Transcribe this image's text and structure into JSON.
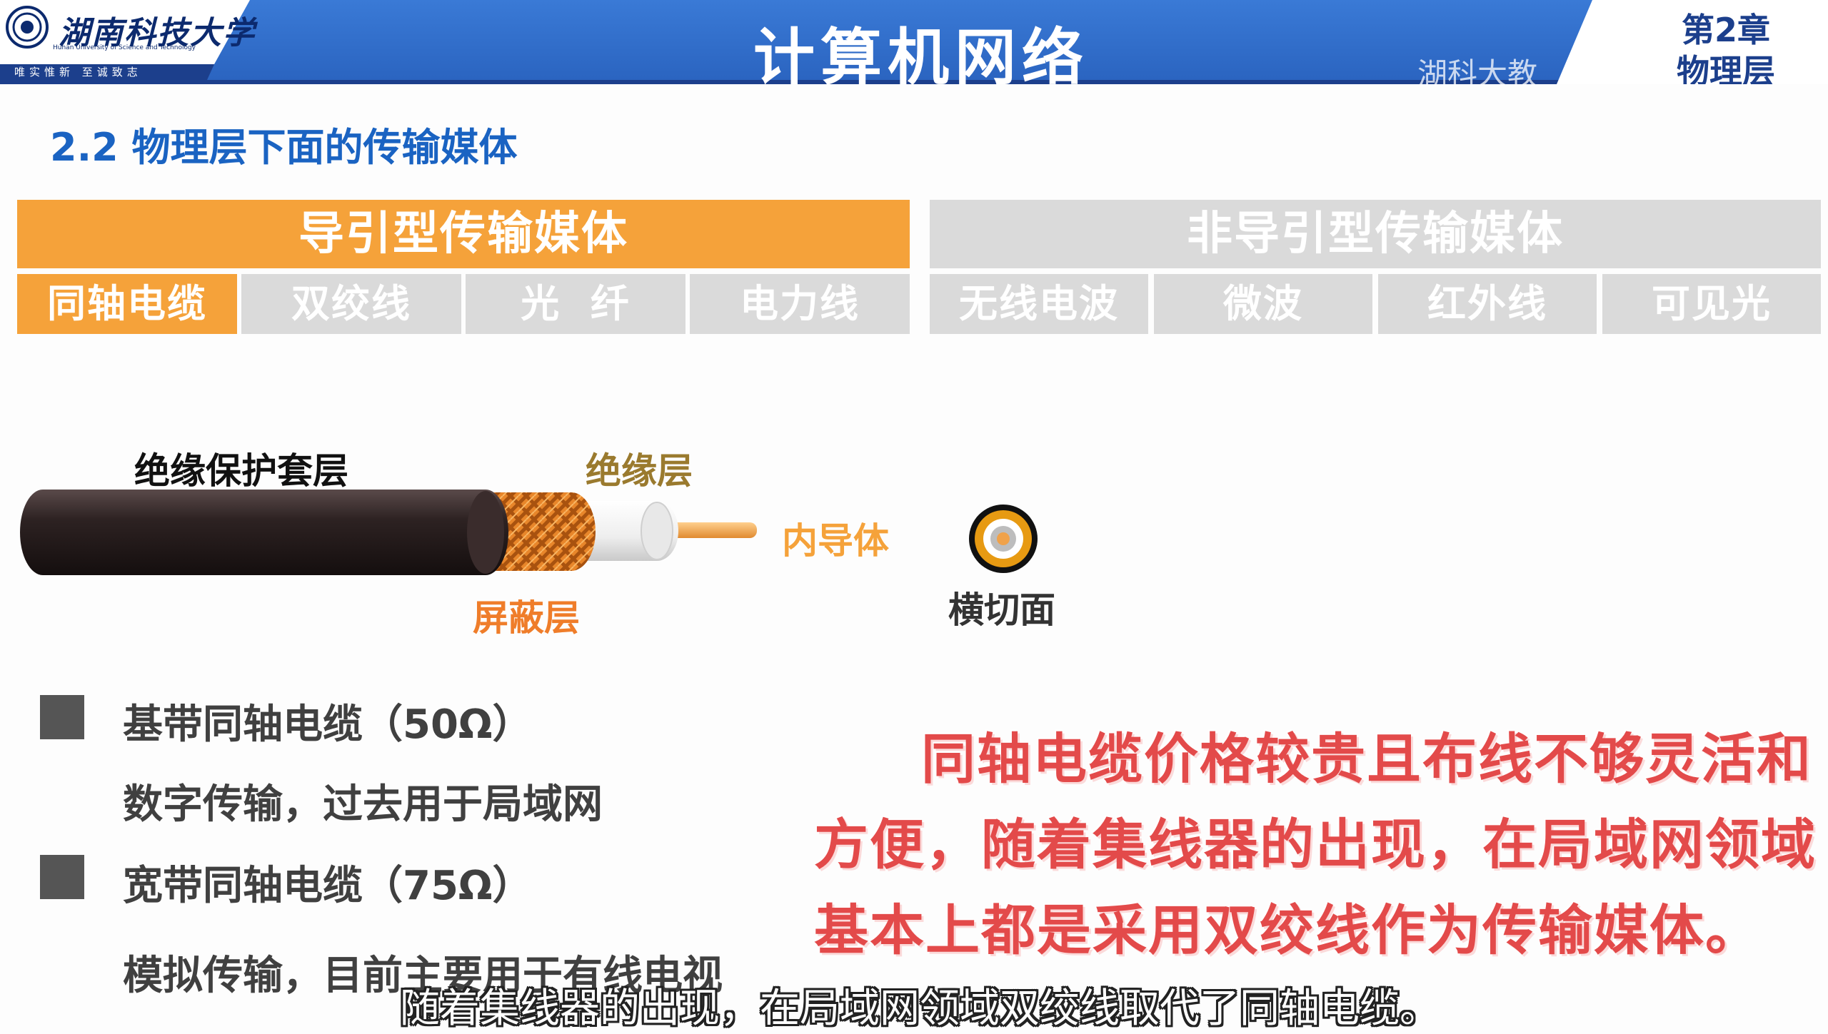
{
  "header": {
    "school_name_cn": "湖南科技大学",
    "school_name_en": "Hunan University of Science and Technology",
    "school_motto": "唯实惟新 至诚致志",
    "course_title": "计算机网络",
    "watermark": "湖科大教",
    "chapter_number": "第2章",
    "chapter_name": "物理层",
    "colors": {
      "band": "#2f6fcf",
      "band_dark": "#1c3f8c",
      "logo_panel": "#ffffff"
    }
  },
  "section_title": "2.2 物理层下面的传输媒体",
  "media_table": {
    "guided": {
      "label": "导引型传输媒体",
      "color": "#f5a23a",
      "tabs": [
        {
          "label": "同轴电缆",
          "active": true
        },
        {
          "label": "双绞线",
          "active": false
        },
        {
          "label": "光  纤",
          "active": false
        },
        {
          "label": "电力线",
          "active": false
        }
      ]
    },
    "unguided": {
      "label": "非导引型传输媒体",
      "color": "#dadada",
      "tabs": [
        {
          "label": "无线电波",
          "active": false
        },
        {
          "label": "微波",
          "active": false
        },
        {
          "label": "红外线",
          "active": false
        },
        {
          "label": "可见光",
          "active": false
        }
      ]
    },
    "colors": {
      "active": "#f5a23a",
      "inactive": "#dadada"
    }
  },
  "cable_diagram": {
    "labels": {
      "jacket": "绝缘保护套层",
      "insulation": "绝缘层",
      "inner_conductor": "内导体",
      "shield": "屏蔽层",
      "cross_section": "横切面"
    },
    "colors": {
      "jacket": "#2d2222",
      "shield": "#e8862a",
      "insulation": "#f2f2f2",
      "conductor": "#f0a24a",
      "ring": "#e79a12"
    }
  },
  "bullets": [
    {
      "title": "基带同轴电缆（50Ω）",
      "desc": "数字传输，过去用于局域网"
    },
    {
      "title": "宽带同轴电缆（75Ω）",
      "desc": "模拟传输，目前主要用于有线电视"
    }
  ],
  "note": {
    "lines": [
      "同轴电缆价格较贵且布线不够灵活和",
      "方便，随着集线器的出现，在局域网领域",
      "基本上都是采用双绞线作为传输媒体。"
    ],
    "color": "#e34a4a"
  },
  "subtitle": "随着集线器的出现，在局域网领域双绞线取代了同轴电缆。"
}
